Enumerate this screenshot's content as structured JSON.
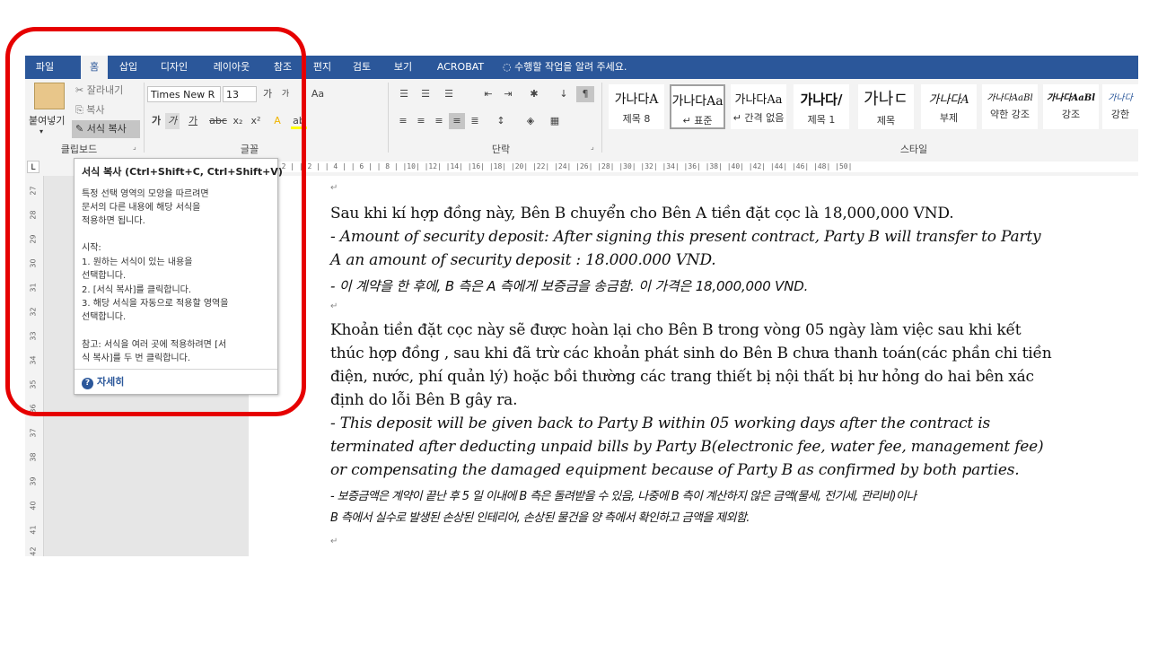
{
  "tabs": [
    "파일",
    "홈",
    "삽입",
    "디자인",
    "레이아웃",
    "참조",
    "편지",
    "검토",
    "보기",
    "ACROBAT"
  ],
  "active_tab": "홈",
  "tell_me": "수행할 작업을 알려 주세요.",
  "clipboard": {
    "paste": "붙여넣기",
    "cut": "잘라내기",
    "copy": "복사",
    "format_painter": "서식 복사",
    "group_label": "클립보드"
  },
  "font": {
    "name": "Times New R",
    "size": "13",
    "group_label": "글꼴"
  },
  "paragraph": {
    "group_label": "단락"
  },
  "styles": {
    "group_label": "스타일",
    "items": [
      {
        "sample": "가나다A",
        "name": "제목 8"
      },
      {
        "sample": "가나다Aa",
        "name": "↵ 표준"
      },
      {
        "sample": "가나다Aa",
        "name": "↵ 간격 없음"
      },
      {
        "sample": "가나다/",
        "name": "제목 1"
      },
      {
        "sample": "가나ㄷ",
        "name": "제목"
      },
      {
        "sample": "가나다A",
        "name": "부제"
      },
      {
        "sample": "가나다AaBl",
        "name": "약한 강조"
      },
      {
        "sample": "가나다AaBl",
        "name": "강조"
      },
      {
        "sample": "가나다",
        "name": "강한"
      }
    ],
    "selected_index": 1
  },
  "ruler_text": "| 2 |   | 2 |   | 4 |   | 6 |   | 8 |  |10|  |12|  |14|  |16|  |18|  |20|  |22|  |24|  |26|  |28|  |30|  |32|  |34|  |36|  |38|  |40|  |42|  |44|  |46|  |48|  |50|",
  "vruler": [
    "27",
    "28",
    "29",
    "30",
    "31",
    "32",
    "33",
    "34",
    "35",
    "36",
    "37",
    "38",
    "39",
    "40",
    "41",
    "42"
  ],
  "tooltip": {
    "title": "서식 복사 (Ctrl+Shift+C, Ctrl+Shift+V)",
    "lines": [
      "특정 선택 영역의 모양을 따르려면",
      "문서의 다른 내용에 해당 서식을",
      "적용하면 됩니다.",
      "",
      "시작:",
      "1. 원하는 서식이 있는 내용을",
      "선택합니다.",
      "2. [서식 복사]를 클릭합니다.",
      "3. 해당 서식을 자동으로 적용할 영역을",
      "선택합니다.",
      "",
      "참고: 서식을 여러 곳에 적용하려면 [서",
      "식 복사]를 두 번 클릭합니다."
    ],
    "help": "자세히"
  },
  "document": {
    "p1_vi": "Sau khi kí hợp đồng này, Bên B chuyển cho Bên A tiền đặt cọc là 18,000,000 VND.",
    "p1_en_1": "- Amount of security deposit: After signing this present contract, Party B will transfer to Party",
    "p1_en_2": "A an amount of security deposit : 18.000.000 VND.",
    "p1_ko": "- 이 계약을 한 후에, B 측은 A 측에게 보증금을 송금함. 이 가격은 18,000,000 VND.",
    "p2_vi_1": "Khoản tiền đặt cọc này sẽ được hoàn lại cho Bên B trong vòng 05 ngày làm việc sau khi kết",
    "p2_vi_2": "thúc hợp đồng , sau khi đã trừ các khoản phát sinh do Bên B chưa thanh toán(các phần chi tiền",
    "p2_vi_3": "điện, nước, phí quản lý) hoặc bồi thường các trang thiết bị nội thất bị hư hỏng do hai bên xác",
    "p2_vi_4": "định do lỗi Bên B gây ra.",
    "p2_en_1": "- This deposit will be given back to Party B within 05 working days after the contract is",
    "p2_en_2": "terminated after deducting unpaid bills by Party B(electronic fee, water fee, management fee)",
    "p2_en_3": "or compensating the damaged equipment because of Party B as confirmed by both parties.",
    "p2_ko_1": "- 보증금액은 계약이 끝난 후 5 일 이내에 B 측은 돌려받을 수 있음, 나중에 B 측이 계산하지 않은 금액(물세, 전기세, 관리비)이나",
    "p2_ko_2": "B 측에서 실수로 발생된 손상된 인테리어, 손상된 물건을 양 측에서 확인하고 금액을 제외함."
  },
  "colors": {
    "tabbar": "#2b579a",
    "highlight": "#e60000",
    "ribbon": "#f3f3f3"
  }
}
